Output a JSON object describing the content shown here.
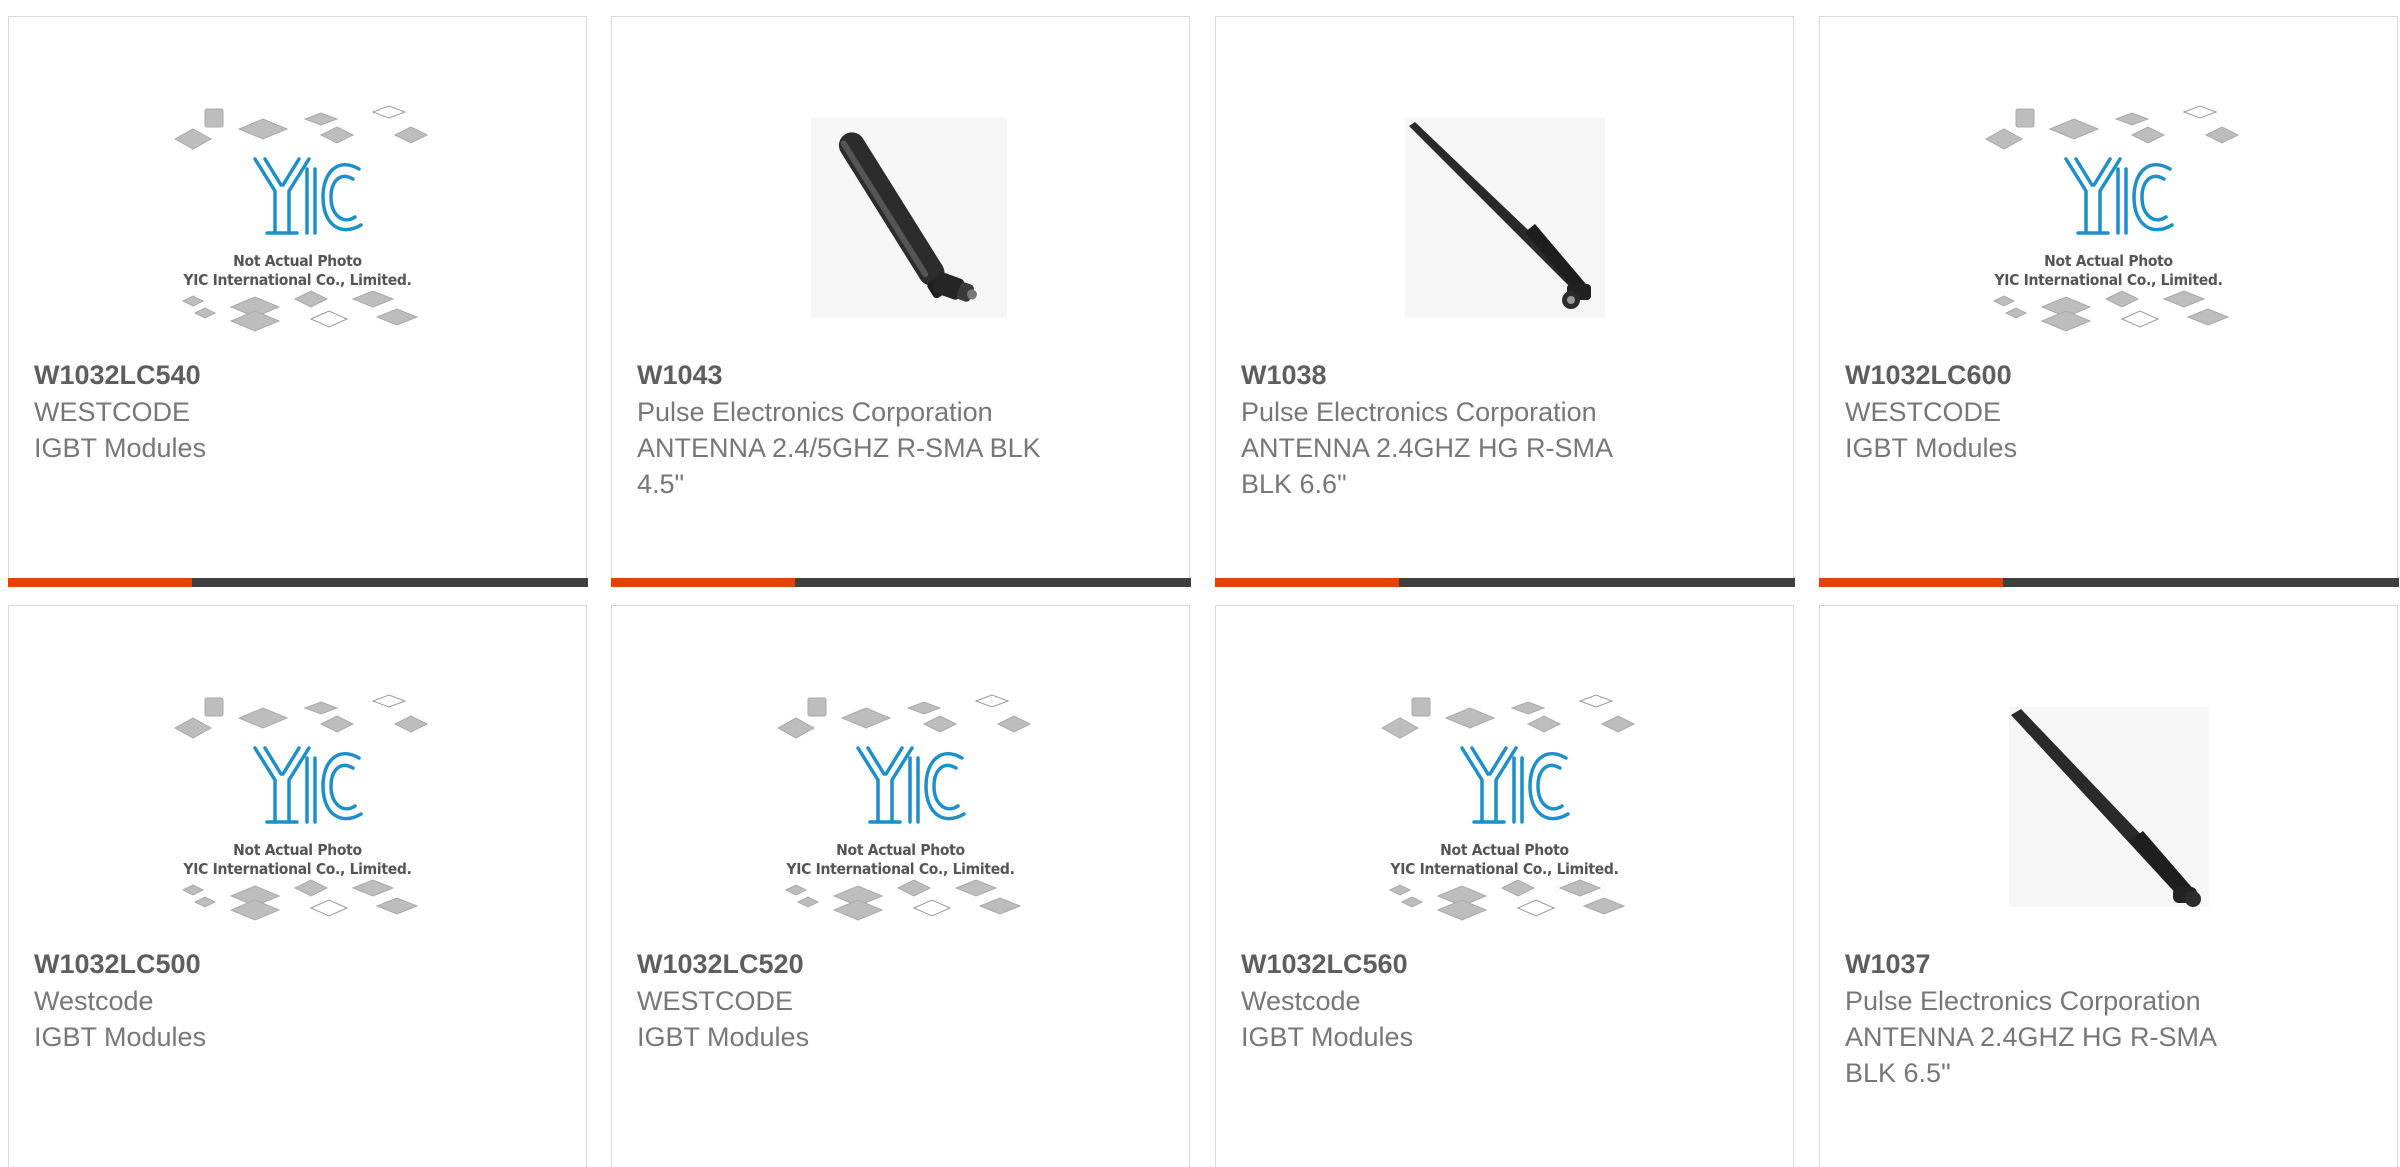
{
  "colors": {
    "accent": "#e8400c",
    "bar": "#3f3f3f",
    "part_number": "#5e5e5e",
    "text": "#777777",
    "yic_blue": "#1f8fc9",
    "chip_gray": "#bdbdbd"
  },
  "placeholder": {
    "caption_line1": "Not Actual Photo",
    "caption_line2": "YIC International Co., Limited."
  },
  "products": [
    {
      "part_number": "W1032LC540",
      "manufacturer": "WESTCODE",
      "description_lines": [
        "IGBT Modules"
      ],
      "image": "yic-placeholder-icon"
    },
    {
      "part_number": "W1043",
      "manufacturer": "Pulse Electronics Corporation",
      "description_lines": [
        "ANTENNA 2.4/5GHZ R-SMA BLK",
        "4.5\""
      ],
      "image": "antenna-thick-icon"
    },
    {
      "part_number": "W1038",
      "manufacturer": "Pulse Electronics Corporation",
      "description_lines": [
        "ANTENNA 2.4GHZ HG R-SMA",
        "BLK 6.6\""
      ],
      "image": "antenna-thin-icon"
    },
    {
      "part_number": "W1032LC600",
      "manufacturer": "WESTCODE",
      "description_lines": [
        "IGBT Modules"
      ],
      "image": "yic-placeholder-icon"
    },
    {
      "part_number": "W1032LC500",
      "manufacturer": "Westcode",
      "description_lines": [
        "IGBT Modules"
      ],
      "image": "yic-placeholder-icon"
    },
    {
      "part_number": "W1032LC520",
      "manufacturer": "WESTCODE",
      "description_lines": [
        "IGBT Modules"
      ],
      "image": "yic-placeholder-icon"
    },
    {
      "part_number": "W1032LC560",
      "manufacturer": "Westcode",
      "description_lines": [
        "IGBT Modules"
      ],
      "image": "yic-placeholder-icon"
    },
    {
      "part_number": "W1037",
      "manufacturer": "Pulse Electronics Corporation",
      "description_lines": [
        "ANTENNA 2.4GHZ HG R-SMA",
        "BLK 6.5\""
      ],
      "image": "antenna-long-icon"
    }
  ]
}
